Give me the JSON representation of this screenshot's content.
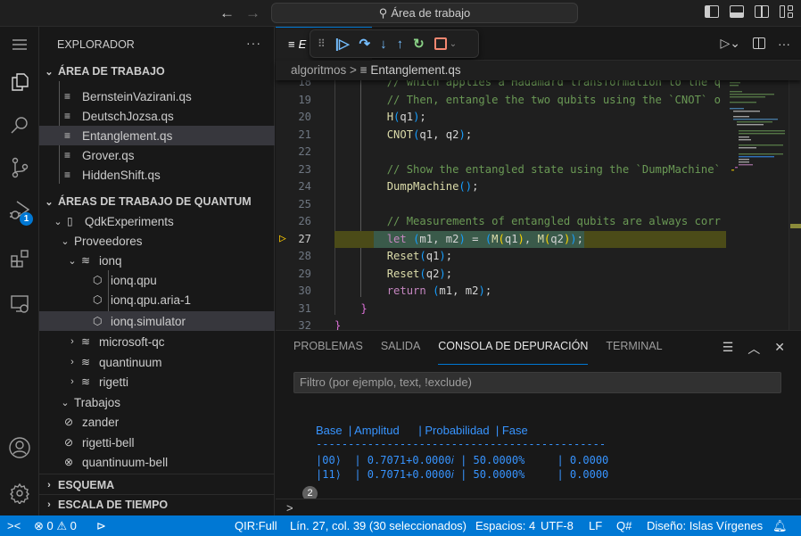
{
  "titlebar": {
    "search_label": "Área de trabajo",
    "icons": [
      "arrow-left-icon",
      "arrow-right-icon",
      "search-icon",
      "toggle-primary-sidebar-icon",
      "toggle-panel-icon",
      "toggle-secondary-sidebar-icon",
      "customize-layout-icon"
    ]
  },
  "activitybar": {
    "items": [
      {
        "name": "menu",
        "icon": "menu-icon"
      },
      {
        "name": "explorer",
        "icon": "files-icon"
      },
      {
        "name": "search",
        "icon": "search-icon"
      },
      {
        "name": "source-control",
        "icon": "source-control-icon"
      },
      {
        "name": "run-debug",
        "icon": "debug-icon",
        "badge": "1"
      },
      {
        "name": "extensions",
        "icon": "extensions-icon"
      },
      {
        "name": "remote-explorer",
        "icon": "remote-explorer-icon"
      },
      {
        "name": "accounts",
        "icon": "account-icon"
      },
      {
        "name": "manage",
        "icon": "gear-icon"
      }
    ],
    "debug_badge": "1"
  },
  "sidebar": {
    "title": "EXPLORADOR",
    "more": "···",
    "workspace_section": "ÁREA DE TRABAJO",
    "workspace_files": [
      "BernsteinVazirani.qs",
      "DeutschJozsa.qs",
      "Entanglement.qs",
      "Grover.qs",
      "HiddenShift.qs"
    ],
    "selected_file": "Entanglement.qs",
    "quantum_section": "ÁREAS DE TRABAJO DE QUANTUM",
    "quantum_workspace": "QdkExperiments",
    "providers_label": "Proveedores",
    "providers": [
      {
        "name": "ionq",
        "expanded": true,
        "targets": [
          "ionq.qpu",
          "ionq.qpu.aria-1",
          "ionq.simulator"
        ]
      },
      {
        "name": "microsoft-qc",
        "expanded": false
      },
      {
        "name": "quantinuum",
        "expanded": false
      },
      {
        "name": "rigetti",
        "expanded": false
      }
    ],
    "selected_target": "ionq.simulator",
    "jobs_label": "Trabajos",
    "jobs": [
      {
        "name": "zander",
        "status": "succeeded"
      },
      {
        "name": "rigetti-bell",
        "status": "succeeded"
      },
      {
        "name": "quantinuum-bell",
        "status": "failed"
      }
    ],
    "outline_section": "ESQUEMA",
    "timeline_section": "ESCALA DE TIEMPO"
  },
  "editor": {
    "tab_label": "E",
    "tab_full": "Entanglement.qs",
    "debug_toolbar": [
      "drag-handle",
      "continue",
      "step-over",
      "step-into",
      "step-out",
      "restart",
      "stop"
    ],
    "breadcrumb": {
      "folder": "algoritmos",
      "separator": ">",
      "file": "Entanglement.qs"
    },
    "current_line": 27,
    "lines": [
      {
        "n": "18",
        "text": "        // which applies a Hadamard transformation to the q"
      },
      {
        "n": "19",
        "text": "        // Then, entangle the two qubits using the `CNOT` o"
      },
      {
        "n": "20",
        "text": "        H(q1);"
      },
      {
        "n": "21",
        "text": "        CNOT(q1, q2);"
      },
      {
        "n": "22",
        "text": ""
      },
      {
        "n": "23",
        "text": "        // Show the entangled state using the `DumpMachine`"
      },
      {
        "n": "24",
        "text": "        DumpMachine();"
      },
      {
        "n": "25",
        "text": ""
      },
      {
        "n": "26",
        "text": "        // Measurements of entangled qubits are always corr"
      },
      {
        "n": "27",
        "text": "        let (m1, m2) = (M(q1), M(q2));"
      },
      {
        "n": "28",
        "text": "        Reset(q1);"
      },
      {
        "n": "29",
        "text": "        Reset(q2);"
      },
      {
        "n": "30",
        "text": "        return (m1, m2);"
      },
      {
        "n": "31",
        "text": "    }"
      },
      {
        "n": "32",
        "text": "}"
      }
    ]
  },
  "panel": {
    "tabs": [
      "PROBLEMAS",
      "SALIDA",
      "CONSOLA DE DEPURACIÓN",
      "TERMINAL"
    ],
    "active_tab": "CONSOLA DE DEPURACIÓN",
    "filter_placeholder": "Filtro (por ejemplo, text, !exclude)",
    "console": {
      "header": "Base  | Amplitud      | Probabilidad  | Fase",
      "divider": "---------------------------------------------",
      "rows": [
        "|00⟩  | 0.7071+0.0000𝑖 | 50.0000%     | 0.0000",
        "|11⟩  | 0.7071+0.0000𝑖 | 50.0000%     | 0.0000"
      ],
      "repeat_count": "2",
      "prompt": ">"
    }
  },
  "statusbar": {
    "remote": "><",
    "errors": "0",
    "warnings": "0",
    "qir": "QIR:Full",
    "cursor": "Lín. 27, col. 39 (30 seleccionados)",
    "spaces": "Espacios: 4",
    "encoding": "UTF-8",
    "eol": "LF",
    "language": "Q#",
    "layout": "Diseño: Islas Vírgenes"
  },
  "colors": {
    "accent": "#0078d4",
    "statusbar": "#0078d4",
    "comment": "#6a9955",
    "function": "#dcdcaa",
    "keyword": "#c586c0",
    "debug_line": "#4b4b18",
    "console_text": "#3794ff"
  }
}
